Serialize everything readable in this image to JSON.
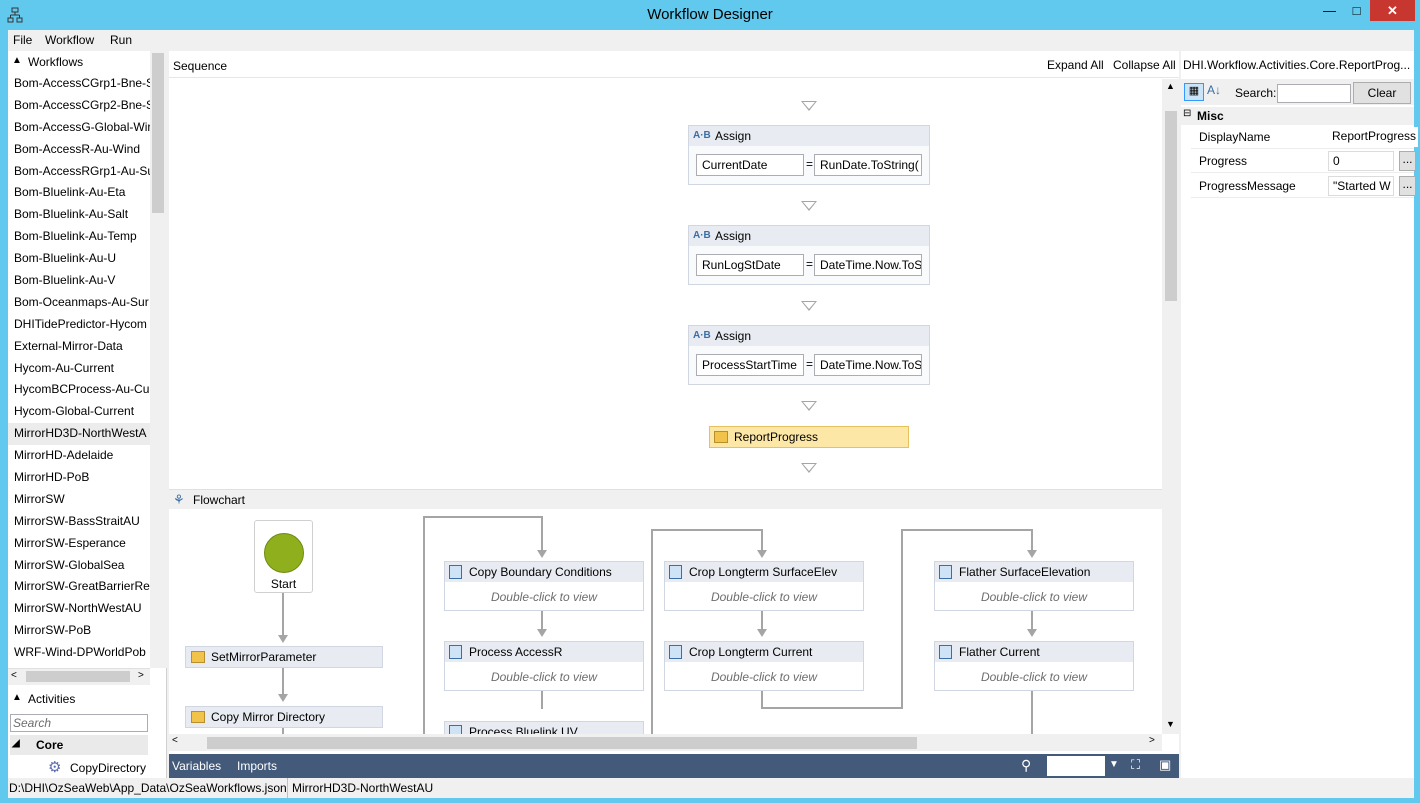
{
  "window": {
    "title": "Workflow Designer",
    "min_label": "—",
    "max_label": "□",
    "close_label": "✕"
  },
  "menu": {
    "items": [
      "File",
      "Workflow",
      "Run"
    ]
  },
  "workflows": {
    "header": "Workflows",
    "items": [
      "Bom-AccessCGrp1-Bne-S",
      "Bom-AccessCGrp2-Bne-S",
      "Bom-AccessG-Global-Wir",
      "Bom-AccessR-Au-Wind",
      "Bom-AccessRGrp1-Au-Su",
      "Bom-Bluelink-Au-Eta",
      "Bom-Bluelink-Au-Salt",
      "Bom-Bluelink-Au-Temp",
      "Bom-Bluelink-Au-U",
      "Bom-Bluelink-Au-V",
      "Bom-Oceanmaps-Au-Sur",
      "DHITidePredictor-Hycom",
      "External-Mirror-Data",
      "Hycom-Au-Current",
      "HycomBCProcess-Au-Cur",
      "Hycom-Global-Current",
      "MirrorHD3D-NorthWestA",
      "MirrorHD-Adelaide",
      "MirrorHD-PoB",
      "MirrorSW",
      "MirrorSW-BassStraitAU",
      "MirrorSW-Esperance",
      "MirrorSW-GlobalSea",
      "MirrorSW-GreatBarrierRe",
      "MirrorSW-NorthWestAU",
      "MirrorSW-PoB",
      "WRF-Wind-DPWorldPob"
    ],
    "selected_index": 16
  },
  "activities": {
    "header": "Activities",
    "search_placeholder": "Search",
    "category": "Core",
    "item": "CopyDirectory"
  },
  "designer": {
    "breadcrumb": "Sequence",
    "expand_all": "Expand All",
    "collapse_all": "Collapse All",
    "assigns": [
      {
        "title": "Assign",
        "to": "CurrentDate",
        "value": "RunDate.ToString("
      },
      {
        "title": "Assign",
        "to": "RunLogStDate",
        "value": "DateTime.Now.ToS"
      },
      {
        "title": "Assign",
        "to": "ProcessStartTime",
        "value": "DateTime.Now.ToS"
      }
    ],
    "assign_icon": "A·B",
    "equals": "=",
    "report_progress": "ReportProgress",
    "flowchart": {
      "title": "Flowchart",
      "start": "Start",
      "set_mirror": "SetMirrorParameter",
      "copy_mirror": "Copy Mirror Directory",
      "activities": [
        {
          "title": "Copy Boundary Conditions",
          "sub": "Double-click to view"
        },
        {
          "title": "Process AccessR",
          "sub": "Double-click to view"
        },
        {
          "title": "Process Bluelink UV",
          "sub": ""
        },
        {
          "title": "Crop Longterm SurfaceElev",
          "sub": "Double-click to view"
        },
        {
          "title": "Crop Longterm Current",
          "sub": "Double-click to view"
        },
        {
          "title": "Flather SurfaceElevation",
          "sub": "Double-click to view"
        },
        {
          "title": "Flather Current",
          "sub": "Double-click to view"
        }
      ]
    },
    "bottom": {
      "variables": "Variables",
      "imports": "Imports"
    }
  },
  "properties": {
    "title": "DHI.Workflow.Activities.Core.ReportProg...",
    "search_label": "Search:",
    "clear_label": "Clear",
    "category": "Misc",
    "rows": [
      {
        "key": "DisplayName",
        "value": "ReportProgress"
      },
      {
        "key": "Progress",
        "value": "0"
      },
      {
        "key": "ProgressMessage",
        "value": "\"Started W"
      }
    ],
    "ellipsis": "..."
  },
  "status": {
    "path": "D:\\DHI\\OzSeaWeb\\App_Data\\OzSeaWorkflows.json",
    "workflow": "MirrorHD3D-NorthWestAU"
  },
  "colors": {
    "titlebar": "#61c9ee",
    "close": "#c7372f",
    "report_fill": "#fde7a6",
    "bottombar": "#435a7a",
    "start_green": "#8fb01c"
  }
}
